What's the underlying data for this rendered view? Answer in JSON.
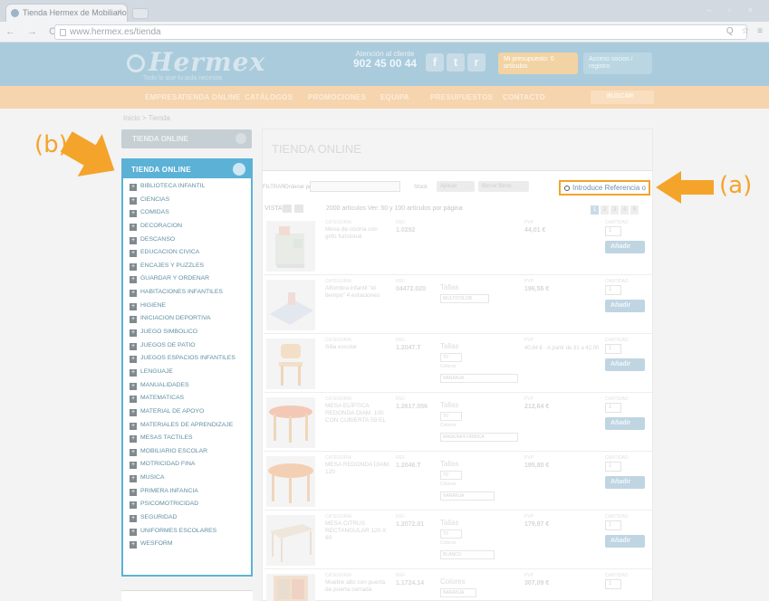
{
  "browser": {
    "tab_title": "Tienda Hermex de Mobiliario",
    "tab_close": "×",
    "url": "www.hermex.es/tienda",
    "nav_buttons": "← → C",
    "window_controls": "– ▫ ×",
    "right_icons": "Q ☆ ≡"
  },
  "header": {
    "logo": "Hermex",
    "tagline": "Todo lo que tu aula necesita",
    "phone_label": "Atención al cliente",
    "phone_number": "902 45 00 44",
    "social": [
      "f",
      "t",
      "r"
    ],
    "cart_label": "Mi presupuesto: 0 artículos",
    "user_label": "Acceso socios / registro"
  },
  "nav": {
    "items": [
      "EMPRESA",
      "TIENDA ONLINE",
      "CATÁLOGOS",
      "PROMOCIONES",
      "EQUIPA",
      "PRESUPUESTOS",
      "CONTACTO"
    ],
    "search_label": "BUSCAR"
  },
  "breadcrumb": "Inicio > Tienda",
  "sidebar": {
    "top_label": "TIENDA ONLINE",
    "panel_title": "TIENDA ONLINE",
    "categories": [
      "BIBLIOTECA INFANTIL",
      "CIENCIAS",
      "COMIDAS",
      "DECORACION",
      "DESCANSO",
      "EDUCACION CIVICA",
      "ENCAJES Y PUZZLES",
      "GUARDAR Y ORDENAR",
      "HABITACIONES INFANTILES",
      "HIGIENE",
      "INICIACION DEPORTIVA",
      "JUEGO SIMBOLICO",
      "JUEGOS DE PATIO",
      "JUEGOS ESPACIOS INFANTILES",
      "LENGUAJE",
      "MANUALIDADES",
      "MATEMATICAS",
      "MATERIAL DE APOYO",
      "MATERIALES DE APRENDIZAJE",
      "MESAS TACTILES",
      "MOBILIARIO ESCOLAR",
      "MOTRICIDAD FINA",
      "MUSICA",
      "PRIMERA INFANCIA",
      "PSICOMOTRICIDAD",
      "SEGURIDAD",
      "UNIFORMES ESCOLARES",
      "WESFORM"
    ]
  },
  "main": {
    "title": "TIENDA ONLINE",
    "filter_label": "FILTRAR:",
    "filter_select_label": "Ordenar por",
    "filter_select2_label": "Stock",
    "filter_btn1": "Aplicar",
    "filter_btn2": "Borrar filtros",
    "search_placeholder": "Introduce Referencia o",
    "view_label": "VISTA",
    "results_text": "2000 artículos   Ver: 50 y 100 artículos por página",
    "pages": [
      "1",
      "2",
      "3",
      "4",
      "5"
    ],
    "col_category": "CATEGORÍA",
    "col_ref": "REF.",
    "col_pvp": "PVP",
    "col_qty": "CANTIDAD",
    "add_label": "Añadir",
    "products": [
      {
        "name": "Mesa de cocina con grifo funcional",
        "ref": "1.0292",
        "option_label": "",
        "option_value": "",
        "option2_label": "",
        "option2_value": "",
        "price": "44,01 €",
        "qty": "1"
      },
      {
        "name": "Alfombra infantil \"el tiempo\" 4 estaciones",
        "ref": "04472.020",
        "option_label": "Tallas",
        "option_value": "MULTICOLOR",
        "option2_label": "",
        "option2_value": "",
        "price": "196,55 €",
        "qty": "1"
      },
      {
        "name": "Silla escolar",
        "ref": "1.2047.T",
        "option_label": "Tallas",
        "option_value": "T0",
        "option2_label": "Colores",
        "option2_value": "NARANJA",
        "price": "40,84 € · A partir de 31 a 42,00",
        "qty": "1"
      },
      {
        "name": "MESA ELÍPTICA REDONDA DIAM. 100 CON CUBIERTA 59 EL",
        "ref": "1.2617.056",
        "option_label": "Tallas",
        "option_value": "T0",
        "option2_label": "Colores",
        "option2_value": "MADERA/FORMICA",
        "price": "212,64 €",
        "qty": "1"
      },
      {
        "name": "MESA REDONDA DIAM. 120",
        "ref": "1.2046.T",
        "option_label": "Tallas",
        "option_value": "T0",
        "option2_label": "Colores",
        "option2_value": "NARANJA",
        "price": "195,80 €",
        "qty": "1"
      },
      {
        "name": "MESA CITRUS RECTANGULAR 120 X 60",
        "ref": "1.2072.01",
        "option_label": "Tallas",
        "option_value": "T0",
        "option2_label": "Colores",
        "option2_value": "BLANCO",
        "price": "179,97 €",
        "qty": "1"
      },
      {
        "name": "Mueble alto con puerta de puerta cerrada",
        "ref": "1.1724.14",
        "option_label": "Colores",
        "option_value": "NARANJA",
        "option2_label": "",
        "option2_value": "",
        "price": "307,09 €",
        "qty": "1"
      }
    ]
  },
  "annotations": {
    "a": "(a)",
    "b": "(b)"
  },
  "colors": {
    "accent_orange": "#f4a42a",
    "sidebar_blue": "#5bb2d6",
    "header_blue": "#aacbdc",
    "nav_peach": "#f6d4ad"
  }
}
